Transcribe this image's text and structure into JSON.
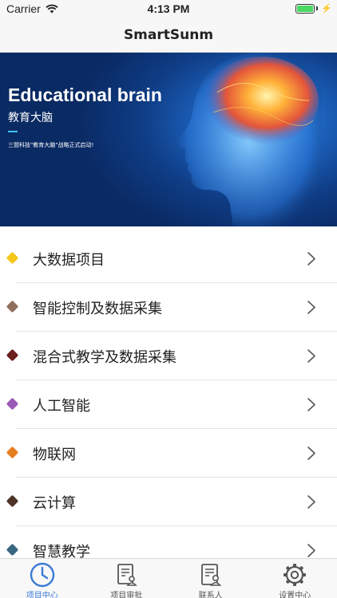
{
  "status_bar": {
    "carrier": "Carrier",
    "time": "4:13 PM",
    "battery_color": "#4cd964"
  },
  "nav": {
    "title": "SmartSunm"
  },
  "banner": {
    "title": "Educational brain",
    "subtitle": "教育大脑",
    "description": "三盟科技\"教育大脑\"战略正式启动!",
    "accent_color": "#3ec6ff"
  },
  "list": {
    "items": [
      {
        "label": "大数据项目",
        "color": "#f7c61a"
      },
      {
        "label": "智能控制及数据采集",
        "color": "#8f6f5d"
      },
      {
        "label": "混合式教学及数据采集",
        "color": "#6b1f1f"
      },
      {
        "label": "人工智能",
        "color": "#9b59b6"
      },
      {
        "label": "物联网",
        "color": "#e67e22"
      },
      {
        "label": "云计算",
        "color": "#4e3326"
      },
      {
        "label": "智慧教学",
        "color": "#3b6682"
      }
    ]
  },
  "tabs": {
    "active_color": "#3a7bd5",
    "inactive_color": "#555555",
    "items": [
      {
        "label": "项目中心",
        "icon": "clock-icon",
        "active": true
      },
      {
        "label": "项目审批",
        "icon": "document-approval-icon",
        "active": false
      },
      {
        "label": "联系人",
        "icon": "contacts-icon",
        "active": false
      },
      {
        "label": "设置中心",
        "icon": "gear-icon",
        "active": false
      }
    ]
  }
}
